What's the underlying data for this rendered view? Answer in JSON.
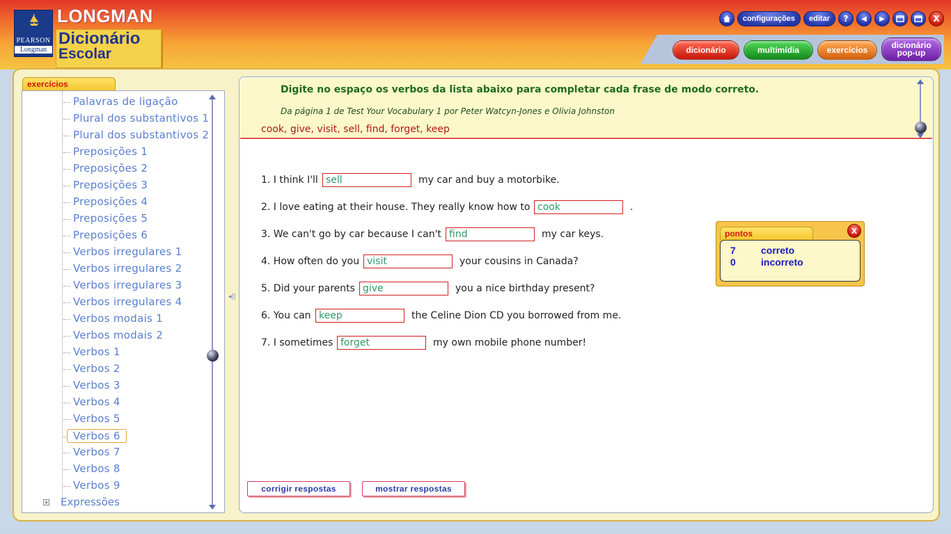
{
  "brand": {
    "publisher_top": "PEARSON",
    "publisher_bottom": "Longman",
    "title_top": "LONGMAN",
    "title_line1": "Dicionário",
    "title_line2": "Escolar"
  },
  "topbar": {
    "home_icon": "home-icon",
    "settings_label": "configurações",
    "edit_label": "editar",
    "help_label": "?",
    "back_glyph": "◀",
    "forward_glyph": "▶",
    "close_label": "X"
  },
  "nav_tabs": [
    {
      "label": "dicionário",
      "color": "#d61d0e"
    },
    {
      "label": "multimídia",
      "color": "#1e9a24"
    },
    {
      "label": "exercícios",
      "color": "#e0741a"
    },
    {
      "label_line1": "dicionário",
      "label_line2": "pop-up",
      "color": "#7b2ab6"
    }
  ],
  "sidebar": {
    "tab_label": "exercícios",
    "items": [
      "Palavras de ligação",
      "Plural dos substantivos 1",
      "Plural dos substantivos 2",
      "Preposições 1",
      "Preposições 2",
      "Preposições 3",
      "Preposições 4",
      "Preposições 5",
      "Preposições 6",
      "Verbos irregulares 1",
      "Verbos irregulares 2",
      "Verbos irregulares 3",
      "Verbos irregulares 4",
      "Verbos modais 1",
      "Verbos modais 2",
      "Verbos 1",
      "Verbos 2",
      "Verbos 3",
      "Verbos 4",
      "Verbos 5",
      "Verbos 6",
      "Verbos 7",
      "Verbos 8",
      "Verbos 9"
    ],
    "selected": "Verbos 6",
    "collapsed_group": "Expressões",
    "expand_glyph": "+"
  },
  "exercise": {
    "instruction": "Digite no espaço os verbos da lista abaixo para completar cada frase de modo correto.",
    "source": "Da página 1 de Test Your Vocabulary 1 por Peter Watcyn-Jones e Olivia Johnston",
    "word_list": "cook, give, visit, sell, find, forget, keep",
    "questions": [
      {
        "before": "1. I think I'll",
        "answer": "sell",
        "after": "my car and buy a motorbike."
      },
      {
        "before": "2. I love eating at their house. They really know how to",
        "answer": "cook",
        "after": "."
      },
      {
        "before": "3. We can't go by car because I can't",
        "answer": "find",
        "after": "my car keys."
      },
      {
        "before": "4. How often do you",
        "answer": "visit",
        "after": "your cousins in Canada?"
      },
      {
        "before": "5. Did your parents",
        "answer": "give",
        "after": "you a nice birthday present?"
      },
      {
        "before": "6. You can",
        "answer": "keep",
        "after": "the Celine Dion CD you borrowed from me."
      },
      {
        "before": "7. I sometimes",
        "answer": "forget",
        "after": "my own mobile phone number!"
      }
    ],
    "check_button": "corrigir respostas",
    "show_button": "mostrar respostas"
  },
  "score": {
    "tab_label": "pontos",
    "close_label": "X",
    "correct_count": "7",
    "correct_label": "correto",
    "incorrect_count": "0",
    "incorrect_label": "incorreto"
  }
}
